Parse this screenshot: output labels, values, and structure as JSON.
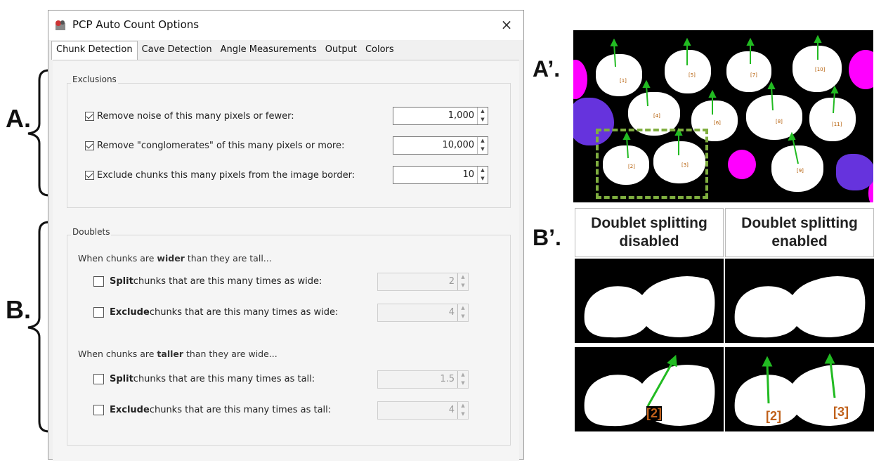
{
  "annotations": {
    "a": "A.",
    "b": "B.",
    "a_prime": "A’.",
    "b_prime": "B’."
  },
  "window": {
    "title": "PCP Auto Count Options",
    "close_icon": "×"
  },
  "tabs": [
    "Chunk Detection",
    "Cave Detection",
    "Angle Measurements",
    "Output",
    "Colors"
  ],
  "exclusions": {
    "legend": "Exclusions",
    "rows": [
      {
        "label": "Remove noise of this many pixels or fewer:",
        "checked": true,
        "value": "1,000"
      },
      {
        "label": "Remove \"conglomerates\" of this many pixels or more:",
        "checked": true,
        "value": "10,000"
      },
      {
        "label": "Exclude chunks this many pixels from the image border:",
        "checked": true,
        "value": "10"
      }
    ]
  },
  "doublets": {
    "legend": "Doublets",
    "wider_prefix": "When chunks are ",
    "wider_bold": "wider",
    "wider_suffix": " than they are tall...",
    "taller_prefix": "When chunks are ",
    "taller_bold": "taller",
    "taller_suffix": " than they are wide...",
    "wide_rows": [
      {
        "bold": "Split",
        "rest": " chunks that are this many times as wide:",
        "checked": false,
        "value": "2"
      },
      {
        "bold": "Exclude",
        "rest": " chunks that are this many times as wide:",
        "checked": false,
        "value": "4"
      }
    ],
    "tall_rows": [
      {
        "bold": "Split",
        "rest": " chunks that are this many times as tall:",
        "checked": false,
        "value": "1.5"
      },
      {
        "bold": "Exclude",
        "rest": " chunks that are this many times as tall:",
        "checked": false,
        "value": "4"
      }
    ]
  },
  "image_a_labels": [
    "[1]",
    "[5]",
    "[7]",
    "[10]",
    "[4]",
    "[6]",
    "[8]",
    "[11]",
    "[2]",
    "[3]",
    "[9]"
  ],
  "comparison": {
    "col1_line1": "Doublet splitting",
    "col1_line2": "disabled",
    "col2_line1": "Doublet splitting",
    "col2_line2": "enabled",
    "bottom_left_label": "[2]",
    "bottom_right_labels": [
      "[2]",
      "[3]"
    ]
  }
}
